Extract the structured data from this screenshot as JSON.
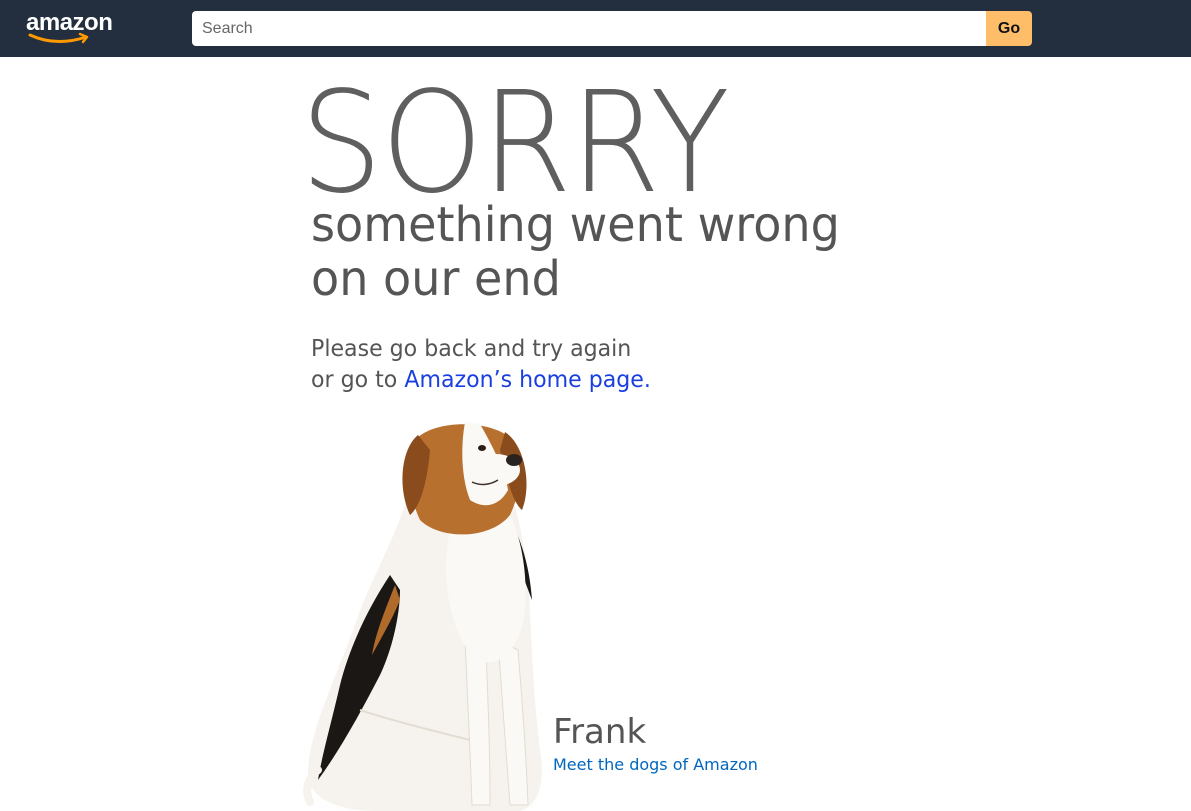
{
  "header": {
    "logo_text": "amazon",
    "logo_icon": "amazon-smile-logo",
    "search": {
      "placeholder": "Search",
      "value": ""
    },
    "go_label": "Go"
  },
  "error": {
    "title": "SORRY",
    "subtitle_line1": "something went wrong",
    "subtitle_line2": "on our end",
    "message_line1": "Please go back and try again",
    "message_line2_prefix": "or go to ",
    "home_link": "Amazon’s home page."
  },
  "dog": {
    "name": "Frank",
    "link": "Meet the dogs of Amazon"
  },
  "colors": {
    "header_bg": "#232f3e",
    "go_button": "#febd69",
    "logo_smile": "#ff9900",
    "link_blue": "#1a3fe0",
    "dog_link": "#0066c0",
    "text_gray": "#555555"
  }
}
